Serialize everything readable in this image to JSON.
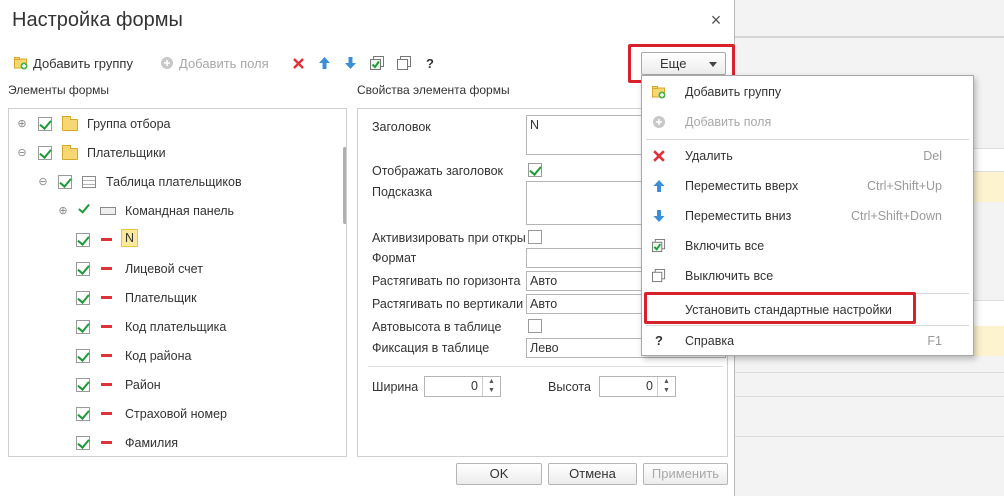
{
  "dialog": {
    "title": "Настройка формы",
    "close_glyph": "×"
  },
  "toolbar": {
    "add_group": "Добавить группу",
    "add_fields": "Добавить поля",
    "help_glyph": "?",
    "more": "Еще"
  },
  "left_title": "Элементы формы",
  "right_title": "Свойства элемента формы",
  "tree": {
    "items": [
      {
        "label": "Группа отбора",
        "type": "group",
        "expander": "⊕"
      },
      {
        "label": "Плательщики",
        "type": "group",
        "expander": "⊖"
      },
      {
        "label": "Таблица плательщиков",
        "type": "table",
        "expander": "⊖"
      },
      {
        "label": "Командная панель",
        "type": "command-bar",
        "expander": "⊕"
      },
      {
        "label": "N",
        "type": "field",
        "selected": true
      },
      {
        "label": "Лицевой счет",
        "type": "field"
      },
      {
        "label": "Плательщик",
        "type": "field"
      },
      {
        "label": "Код плательщика",
        "type": "field"
      },
      {
        "label": "Код района",
        "type": "field"
      },
      {
        "label": "Район",
        "type": "field"
      },
      {
        "label": "Страховой номер",
        "type": "field"
      },
      {
        "label": "Фамилия",
        "type": "field"
      }
    ]
  },
  "props": {
    "title_label": "Заголовок",
    "title_value": "N",
    "show_title_label": "Отображать заголовок",
    "hint_label": "Подсказка",
    "activate_label": "Активизировать при откры",
    "format_label": "Формат",
    "stretch_h_label": "Растягивать по горизонта",
    "stretch_h_value": "Авто",
    "stretch_v_label": "Растягивать по вертикали",
    "stretch_v_value": "Авто",
    "autoheight_label": "Автовысота в таблице",
    "fix_label": "Фиксация в таблице",
    "fix_value": "Лево",
    "width_label": "Ширина",
    "width_value": "0",
    "height_label": "Высота",
    "height_value": "0",
    "spin_up": "▲",
    "spin_down": "▼"
  },
  "buttons": {
    "ok": "OK",
    "cancel": "Отмена",
    "apply": "Применить"
  },
  "menu": {
    "items": [
      {
        "label": "Добавить группу",
        "icon": "folder-add-icon"
      },
      {
        "label": "Добавить поля",
        "icon": "add-field-icon",
        "disabled": true
      },
      {
        "label": "Удалить",
        "icon": "delete-icon",
        "shortcut": "Del"
      },
      {
        "label": "Переместить вверх",
        "icon": "arrow-up-icon",
        "shortcut": "Ctrl+Shift+Up"
      },
      {
        "label": "Переместить вниз",
        "icon": "arrow-down-icon",
        "shortcut": "Ctrl+Shift+Down"
      },
      {
        "label": "Включить все",
        "icon": "check-all-icon"
      },
      {
        "label": "Выключить все",
        "icon": "uncheck-all-icon"
      },
      {
        "label": "Установить стандартные настройки",
        "icon": ""
      },
      {
        "label": "Справка",
        "icon": "help-icon",
        "glyph": "?",
        "shortcut": "F1"
      }
    ]
  },
  "colors": {
    "highlight_border": "#d9212b",
    "check_green": "#1e9a38",
    "delete_red": "#e0303a",
    "arrow_blue": "#3a8fd6",
    "selected_bg": "#fbe99a"
  }
}
